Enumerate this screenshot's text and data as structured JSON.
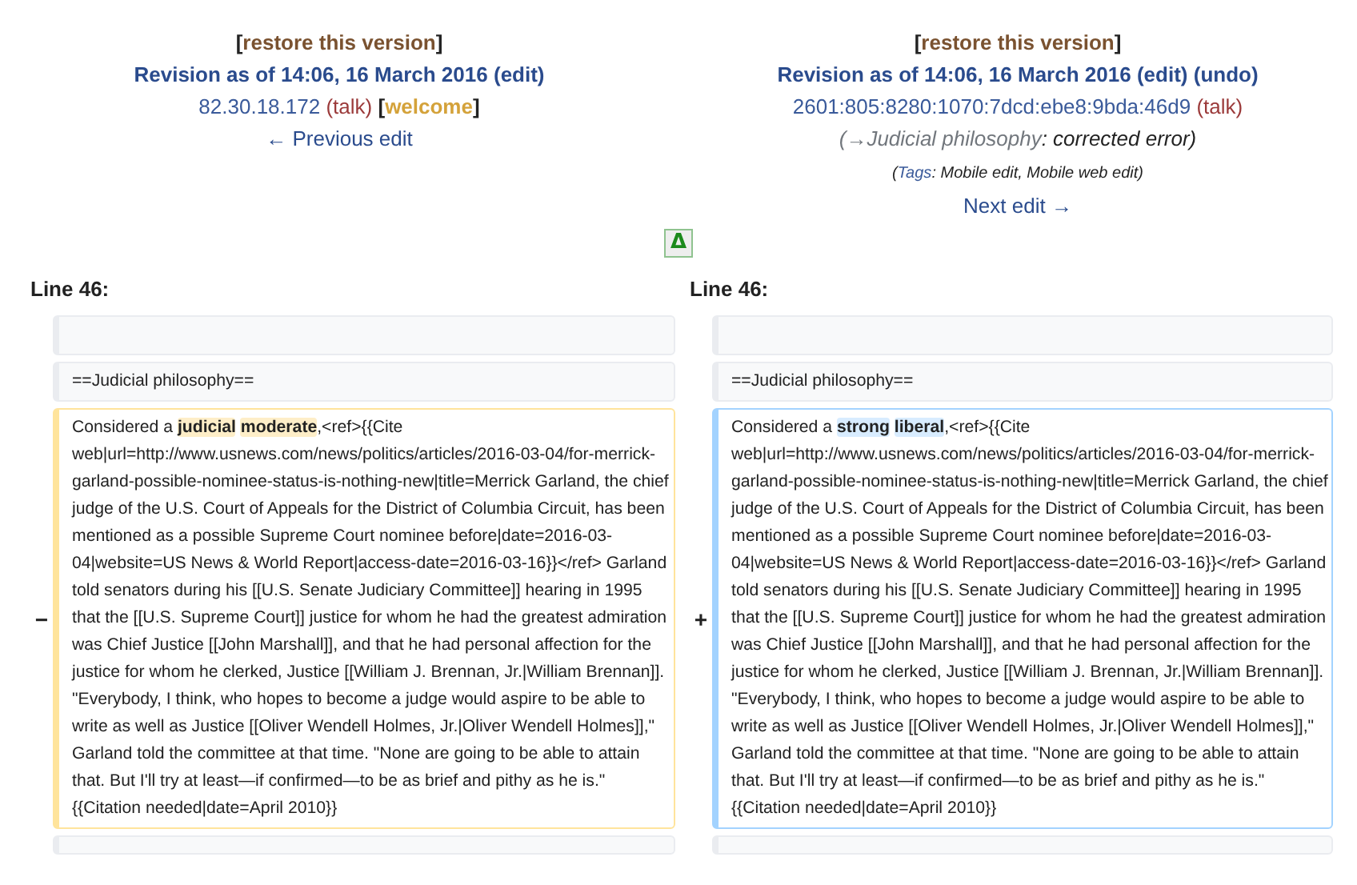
{
  "left_header": {
    "restore": {
      "open": "[",
      "link": "restore this version",
      "close": "]"
    },
    "revision": "Revision as of 14:06, 16 March 2016",
    "revision_links": [
      "(edit)"
    ],
    "user": "82.30.18.172",
    "user_talk": "(talk)",
    "welcome": {
      "open": "[",
      "link": "welcome",
      "close": "]"
    },
    "nav": "← Previous edit"
  },
  "right_header": {
    "restore": {
      "open": "[",
      "link": "restore this version",
      "close": "]"
    },
    "revision": "Revision as of 14:06, 16 March 2016",
    "revision_links": [
      "(edit)",
      "(undo)"
    ],
    "user": "2601:805:8280:1070:7dcd:ebe8:9bda:46d9",
    "user_talk": "(talk)",
    "summary": {
      "open": "(",
      "section": "→Judicial philosophy",
      "comment": ": corrected error)"
    },
    "tags": {
      "open": "(",
      "label": "Tags",
      "list": ": Mobile edit, Mobile web edit)"
    },
    "nav": "Next edit →"
  },
  "toggle": "Δ",
  "line_labels": [
    "Line 46:",
    "Line 46:"
  ],
  "rows": [
    {
      "kind": "context",
      "left": [],
      "right": []
    },
    {
      "kind": "context",
      "left": [
        {
          "text": "==Judicial philosophy==",
          "changed": false
        }
      ],
      "right": [
        {
          "text": "==Judicial philosophy==",
          "changed": false
        }
      ]
    },
    {
      "kind": "change",
      "left_marker": "−",
      "right_marker": "+",
      "left": [
        {
          "text": "Considered a ",
          "changed": false
        },
        {
          "text": "judicial moderate",
          "changed": true
        },
        {
          "text": ",<ref>{{Cite web|url=http://www.usnews.com/news/politics/articles/2016-03-04/for-merrick-garland-possible-nominee-status-is-nothing-new|title=Merrick Garland, the chief judge of the U.S. Court of Appeals for the District of Columbia Circuit, has been mentioned as a possible Supreme Court nominee before|date=2016-03-04|website=US News & World Report|access-date=2016-03-16}}</ref> Garland told senators during his [[U.S. Senate Judiciary Committee]] hearing in 1995 that the [[U.S. Supreme Court]] justice for whom he had the greatest admiration was Chief Justice [[John Marshall]], and that he had personal affection for the justice for whom he clerked, Justice [[William J. Brennan, Jr.|William Brennan]]. \"Everybody, I think, who hopes to become a judge would aspire to be able to write as well as Justice [[Oliver Wendell Holmes, Jr.|Oliver Wendell Holmes]],\" Garland told the committee at that time. \"None are going to be able to attain that. But I'll try at least—if confirmed—to be as brief and pithy as he is.\" {{Citation needed|date=April 2010}}",
          "changed": false
        }
      ],
      "right": [
        {
          "text": "Considered a ",
          "changed": false
        },
        {
          "text": "strong liberal",
          "changed": true
        },
        {
          "text": ",<ref>{{Cite web|url=http://www.usnews.com/news/politics/articles/2016-03-04/for-merrick-garland-possible-nominee-status-is-nothing-new|title=Merrick Garland, the chief judge of the U.S. Court of Appeals for the District of Columbia Circuit, has been mentioned as a possible Supreme Court nominee before|date=2016-03-04|website=US News & World Report|access-date=2016-03-16}}</ref> Garland told senators during his [[U.S. Senate Judiciary Committee]] hearing in 1995 that the [[U.S. Supreme Court]] justice for whom he had the greatest admiration was Chief Justice [[John Marshall]], and that he had personal affection for the justice for whom he clerked, Justice [[William J. Brennan, Jr.|William Brennan]]. \"Everybody, I think, who hopes to become a judge would aspire to be able to write as well as Justice [[Oliver Wendell Holmes, Jr.|Oliver Wendell Holmes]],\" Garland told the committee at that time. \"None are going to be able to attain that. But I'll try at least—if confirmed—to be as brief and pithy as he is.\" {{Citation needed|date=April 2010}}",
          "changed": false
        }
      ]
    },
    {
      "kind": "context",
      "left": [],
      "right": []
    }
  ]
}
